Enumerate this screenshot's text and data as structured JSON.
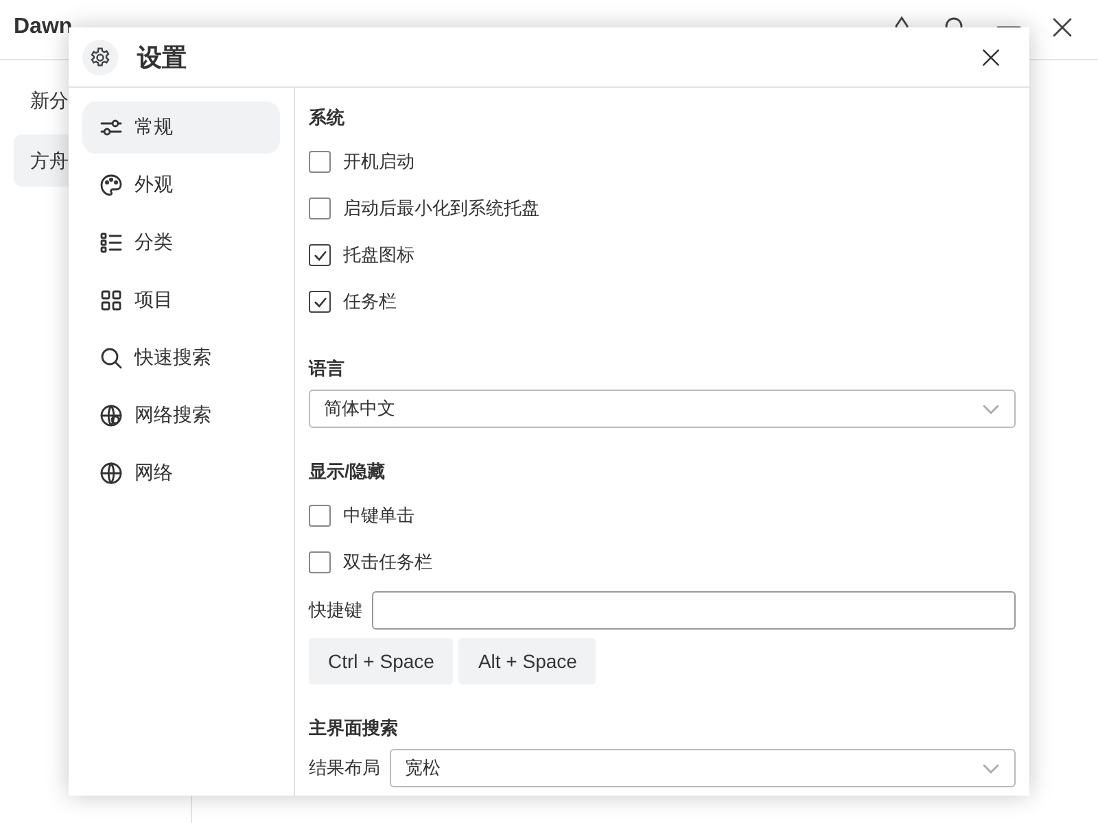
{
  "app": {
    "title": "Dawn",
    "sidebar": [
      {
        "label": "新分",
        "selected": false
      },
      {
        "label": "方舟",
        "selected": true
      }
    ]
  },
  "dialog": {
    "title": "设置",
    "nav": [
      {
        "label": "常规",
        "selected": true
      },
      {
        "label": "外观",
        "selected": false
      },
      {
        "label": "分类",
        "selected": false
      },
      {
        "label": "项目",
        "selected": false
      },
      {
        "label": "快速搜索",
        "selected": false
      },
      {
        "label": "网络搜索",
        "selected": false
      },
      {
        "label": "网络",
        "selected": false
      }
    ],
    "sections": [
      {
        "heading": "系统",
        "items": [
          {
            "kind": "checkbox",
            "label": "开机启动",
            "checked": false
          },
          {
            "kind": "checkbox",
            "label": "启动后最小化到系统托盘",
            "checked": false
          },
          {
            "kind": "checkbox",
            "label": "托盘图标",
            "checked": true
          },
          {
            "kind": "checkbox",
            "label": "任务栏",
            "checked": true
          }
        ]
      },
      {
        "heading": "语言",
        "items": [
          {
            "kind": "select",
            "value": "简体中文"
          }
        ]
      },
      {
        "heading": "显示/隐藏",
        "items": [
          {
            "kind": "checkbox",
            "label": "中键单击",
            "checked": false
          },
          {
            "kind": "checkbox",
            "label": "双击任务栏",
            "checked": false
          },
          {
            "kind": "field",
            "label": "快捷键"
          },
          {
            "kind": "buttons",
            "buttons": [
              "Ctrl + Space",
              "Alt + Space"
            ]
          }
        ]
      },
      {
        "heading": "主界面搜索",
        "items": [
          {
            "kind": "select",
            "label": "结果布局",
            "value": "宽松"
          }
        ]
      }
    ]
  }
}
